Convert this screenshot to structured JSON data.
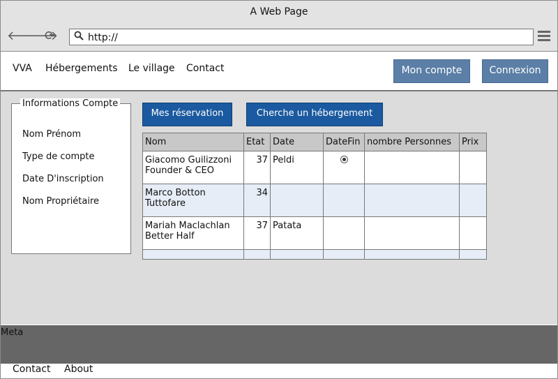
{
  "window": {
    "title": "A Web Page"
  },
  "browser": {
    "url": "http://"
  },
  "nav": {
    "links": [
      "VVA",
      "Hébergements",
      "Le village",
      "Contact"
    ],
    "account_button": "Mon compte",
    "login_button": "Connexion"
  },
  "account_panel": {
    "title": "Informations Compte",
    "items": [
      "Nom Prénom",
      "Type de compte",
      "Date D'inscription",
      "Nom Propriétaire"
    ]
  },
  "actions": {
    "reservations_button": "Mes réservation",
    "search_button": "Cherche un hébergement"
  },
  "table": {
    "headers": [
      "Nom",
      "Etat",
      "Date",
      "DateFin",
      "nombre Personnes",
      "Prix"
    ],
    "rows": [
      {
        "name_line1": "Giacomo Guilizzoni",
        "name_line2": "Founder & CEO",
        "etat": "37",
        "date": "Peldi",
        "datefin_radio": true
      },
      {
        "name_line1": "Marco Botton",
        "name_line2": "Tuttofare",
        "etat": "34",
        "date": "",
        "datefin_radio": false
      },
      {
        "name_line1": "Mariah Maclachlan",
        "name_line2": "Better Half",
        "etat": "37",
        "date": "Patata",
        "datefin_radio": false
      }
    ]
  },
  "meta": {
    "label": "Meta"
  },
  "footer": {
    "links": [
      "Contact",
      "About"
    ]
  }
}
